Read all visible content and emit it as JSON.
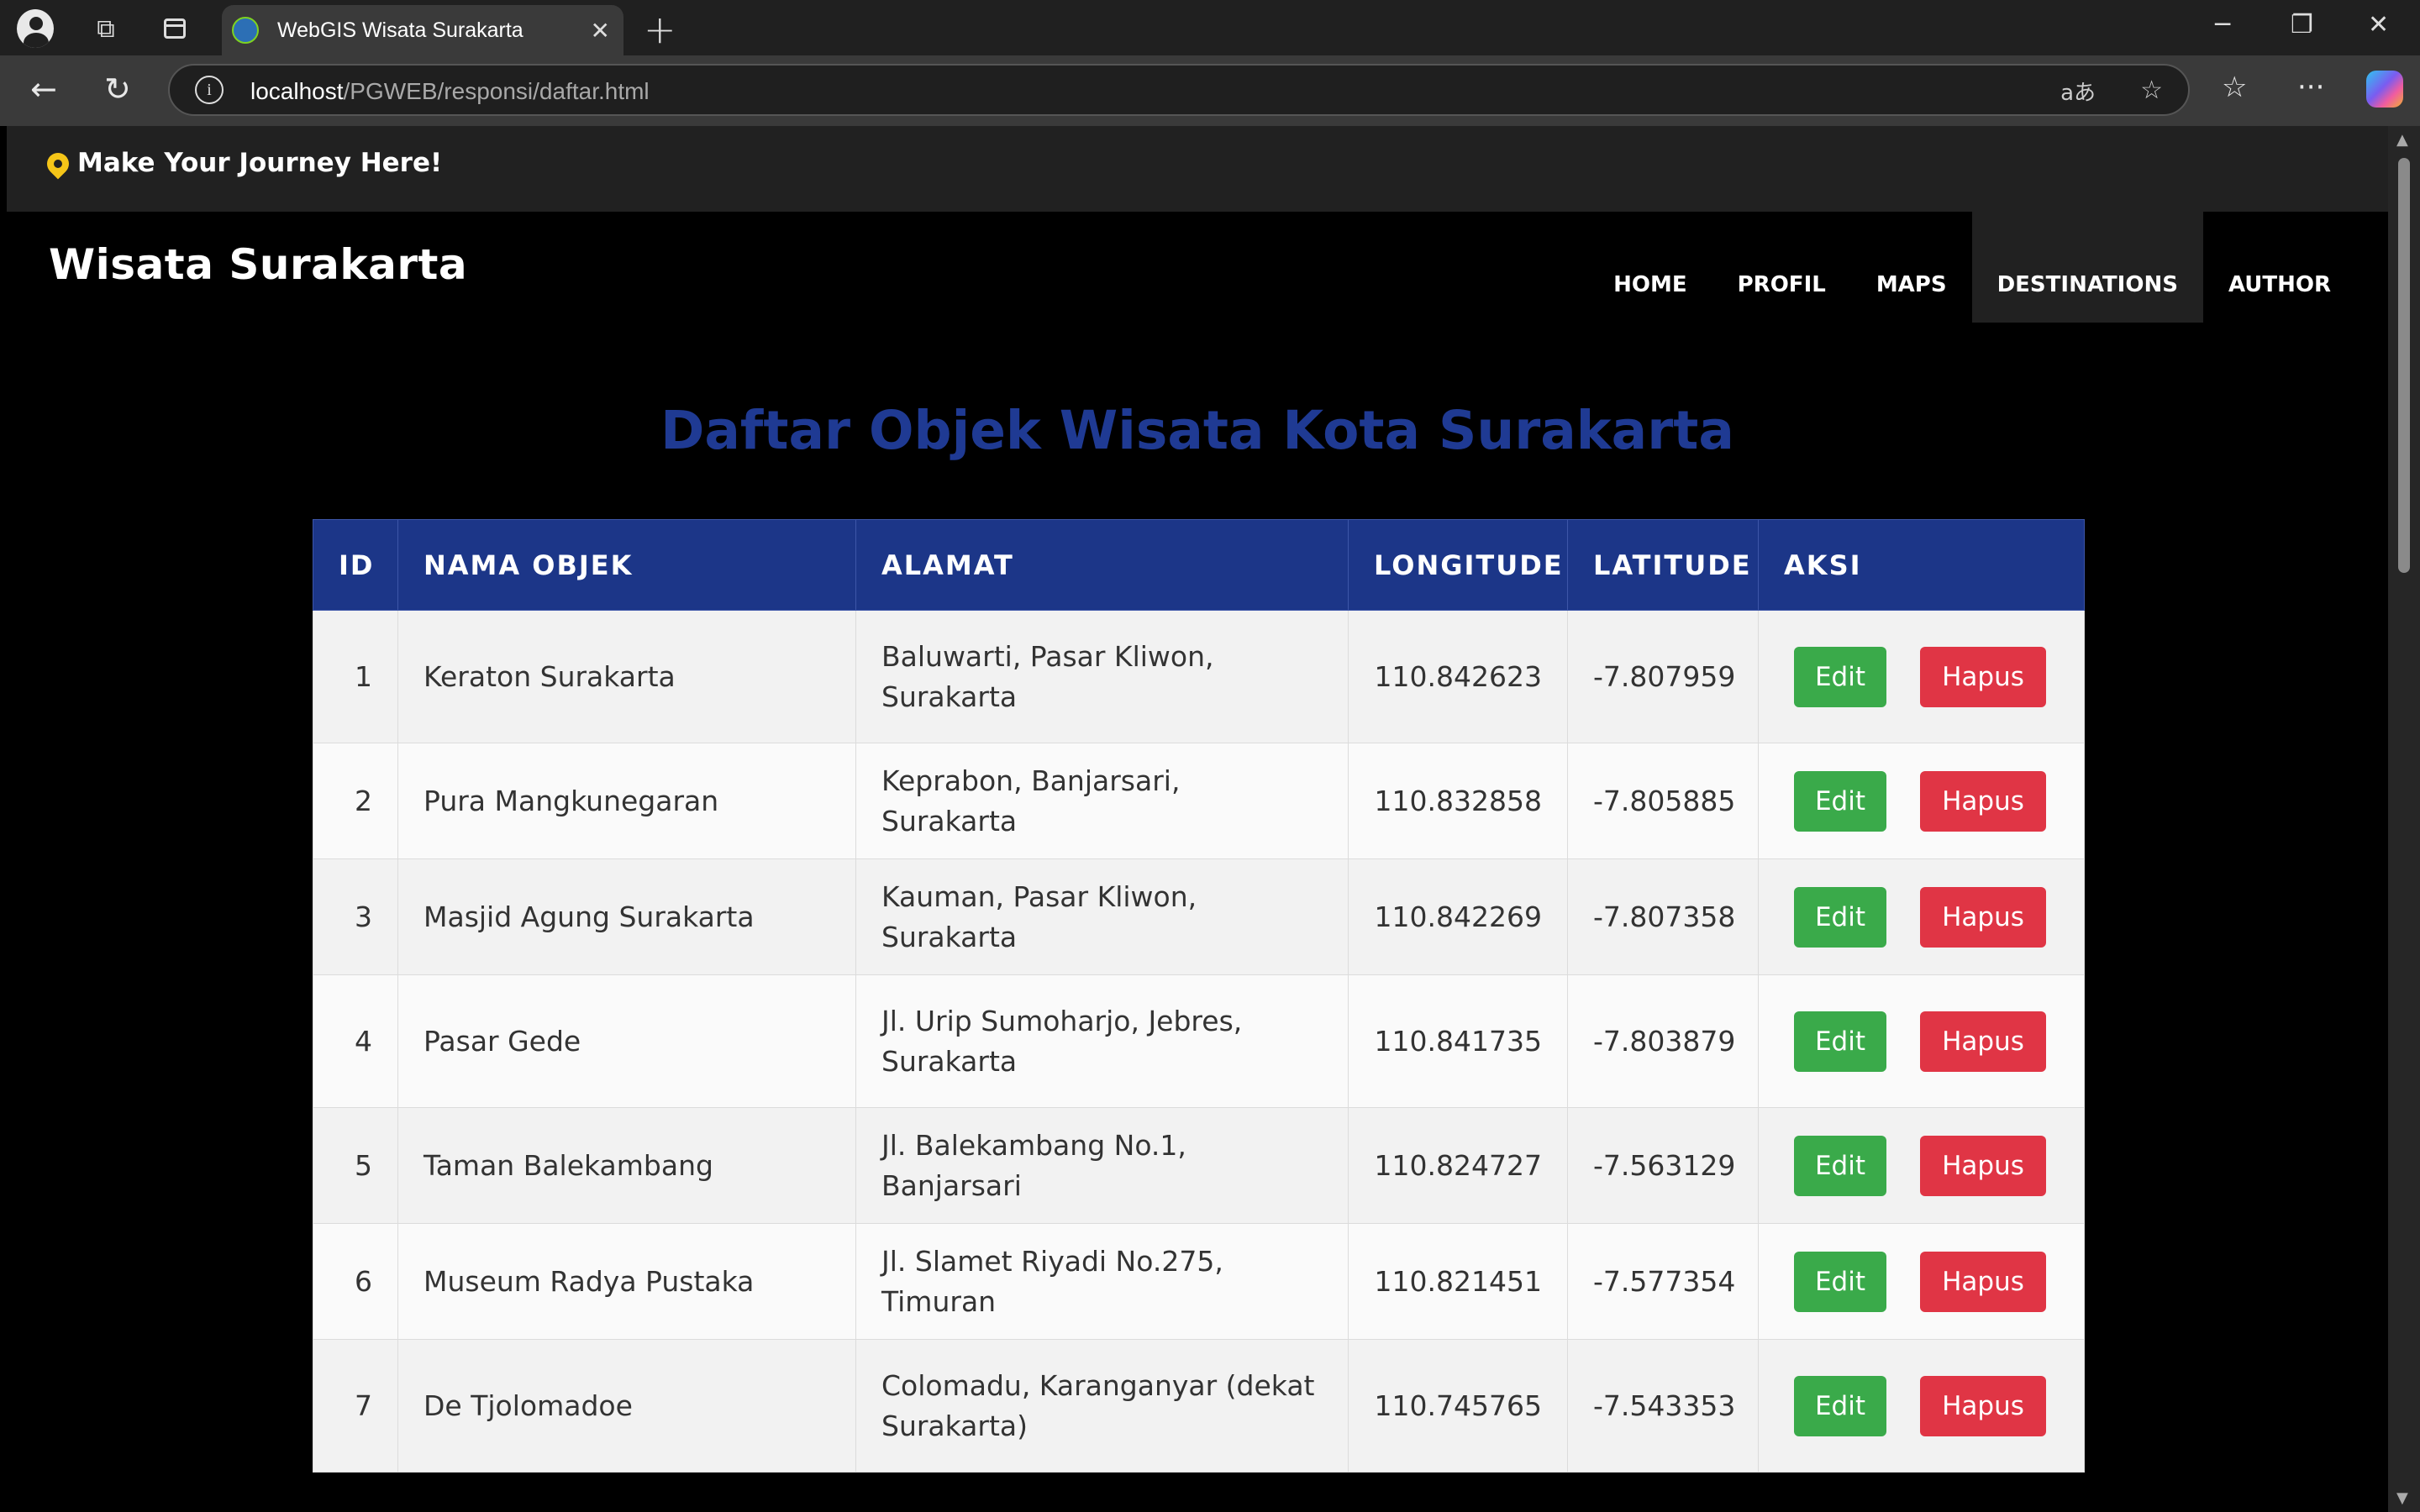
{
  "browser": {
    "tab_title": "WebGIS Wisata Surakarta",
    "url_host": "localhost",
    "url_path": "/PGWEB/responsi/daftar.html"
  },
  "site": {
    "tagline": "Make Your Journey Here!",
    "brand": "Wisata Surakarta",
    "menu": [
      "HOME",
      "PROFIL",
      "MAPS",
      "DESTINATIONS",
      "AUTHOR"
    ],
    "active_menu": "DESTINATIONS"
  },
  "main": {
    "title": "Daftar Objek Wisata Kota Surakarta",
    "columns": [
      "ID",
      "NAMA OBJEK",
      "ALAMAT",
      "LONGITUDE",
      "LATITUDE",
      "AKSI"
    ],
    "edit_label": "Edit",
    "delete_label": "Hapus",
    "rows": [
      {
        "id": "1",
        "nama": "Keraton Surakarta",
        "alamat": "Baluwarti, Pasar Kliwon, Surakarta",
        "lon": "110.842623",
        "lat": "-7.807959"
      },
      {
        "id": "2",
        "nama": "Pura Mangkunegaran",
        "alamat": "Keprabon, Banjarsari, Surakarta",
        "lon": "110.832858",
        "lat": "-7.805885"
      },
      {
        "id": "3",
        "nama": "Masjid Agung Surakarta",
        "alamat": "Kauman, Pasar Kliwon, Surakarta",
        "lon": "110.842269",
        "lat": "-7.807358"
      },
      {
        "id": "4",
        "nama": "Pasar Gede",
        "alamat": "Jl. Urip Sumoharjo, Jebres, Surakarta",
        "lon": "110.841735",
        "lat": "-7.803879"
      },
      {
        "id": "5",
        "nama": "Taman Balekambang",
        "alamat": "Jl. Balekambang No.1, Banjarsari",
        "lon": "110.824727",
        "lat": "-7.563129"
      },
      {
        "id": "6",
        "nama": "Museum Radya Pustaka",
        "alamat": "Jl. Slamet Riyadi No.275, Timuran",
        "lon": "110.821451",
        "lat": "-7.577354"
      },
      {
        "id": "7",
        "nama": "De Tjolomadoe",
        "alamat": "Colomadu, Karanganyar (dekat Surakarta)",
        "lon": "110.745765",
        "lat": "-7.543353"
      }
    ]
  },
  "colors": {
    "header_bg": "#1c3688",
    "title": "#1f3a93",
    "edit": "#3aaa4a",
    "delete": "#e03545",
    "pin": "#f5c518"
  }
}
